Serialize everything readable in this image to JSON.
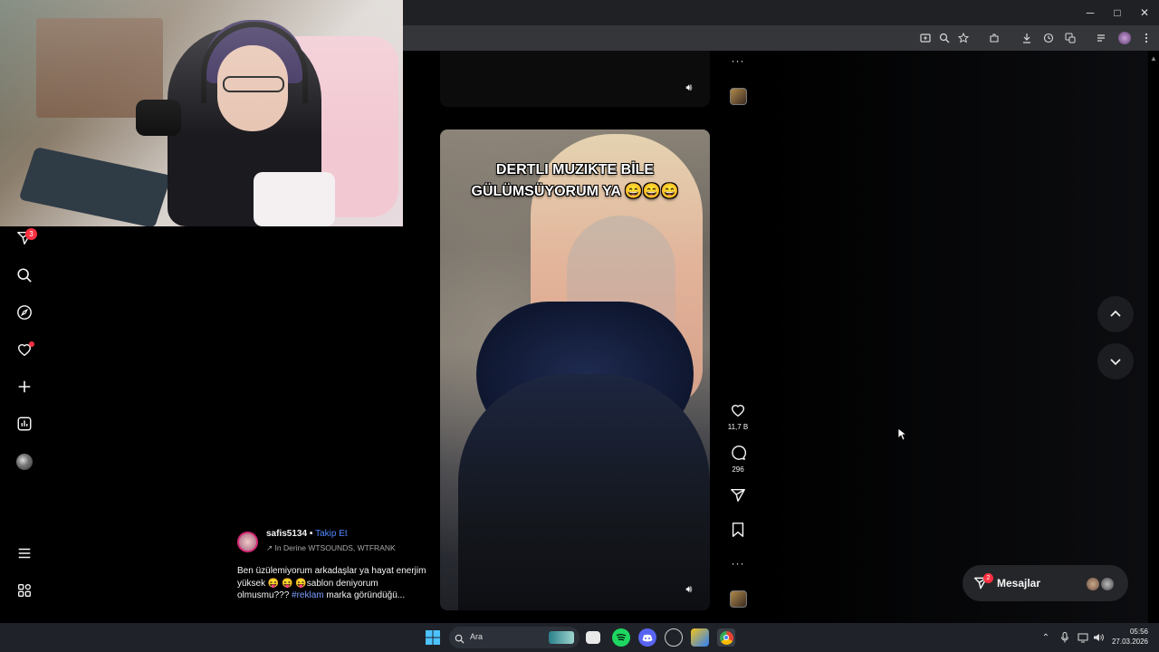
{
  "browser": {
    "window_controls": {
      "minimize": "─",
      "maximize": "□",
      "close": "✕"
    },
    "toolbar_icons": [
      "screen-cast-icon",
      "zoom-icon",
      "star-icon",
      "extensions-icon",
      "download-icon",
      "history-icon",
      "translate-icon",
      "media-icon",
      "profile-icon",
      "menu-icon"
    ]
  },
  "sidebar": {
    "messages_badge": "3",
    "items": [
      {
        "name": "direct-messages-icon"
      },
      {
        "name": "search-icon"
      },
      {
        "name": "explore-icon"
      },
      {
        "name": "notifications-icon"
      },
      {
        "name": "create-icon"
      },
      {
        "name": "dashboard-icon"
      },
      {
        "name": "profile-avatar"
      }
    ],
    "bottom": [
      {
        "name": "more-menu-icon"
      },
      {
        "name": "also-from-meta-icon"
      }
    ]
  },
  "reel": {
    "caption_line1": "DERTLI MUZIKTE BİLE",
    "caption_line2": "GÜLÜMSÜYORUM YA 😄😄😄"
  },
  "actions": {
    "likes": "11,7 B",
    "comments": "296"
  },
  "post": {
    "username": "safis5134",
    "separator": "•",
    "follow": "Takip Et",
    "audio_prefix": "↗",
    "audio": "In Derine  WTSOUNDS, WTFRANK",
    "description": "Ben üzülemiyorum arkadaşlar ya hayat enerjim yüksek 😝 😝 😝sablon deniyorum olmusmu??? ",
    "hashtag": "#reklam",
    "description_tail": " marka göründüğü..."
  },
  "messages": {
    "label": "Mesajlar",
    "badge": "2"
  },
  "taskbar": {
    "search_placeholder": "Ara",
    "time": "05:56",
    "date": "27.03.2026"
  },
  "colors": {
    "background": "#000000",
    "accent_blue": "#4f87ff",
    "notification_red": "#ff3040"
  }
}
